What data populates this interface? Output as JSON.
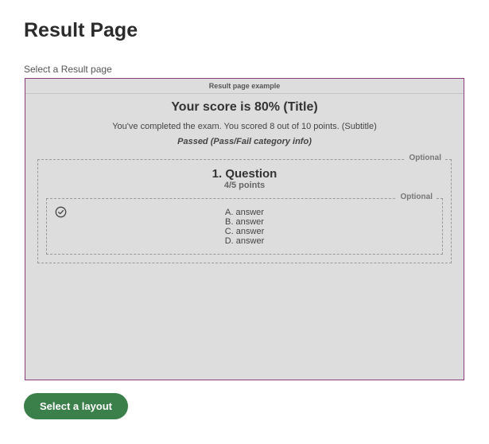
{
  "page": {
    "title": "Result Page",
    "select_label": "Select a Result page"
  },
  "preview": {
    "header": "Result page example",
    "score_title": "Your score is 80% (Title)",
    "subtitle": "You've completed the exam. You scored 8 out of 10 points. (Subtitle)",
    "pass_info": "Passed (Pass/Fail category info)",
    "question": {
      "optional_label": "Optional",
      "title": "1. Question",
      "points": "4/5 points",
      "answers_optional_label": "Optional",
      "check_icon": "check-circle-icon",
      "answers": [
        "A. answer",
        "B. answer",
        "C. answer",
        "D. answer"
      ]
    }
  },
  "actions": {
    "select_layout_label": "Select a layout",
    "accent_color": "#3b7f4a",
    "preview_border_color": "#8b3a7d"
  }
}
